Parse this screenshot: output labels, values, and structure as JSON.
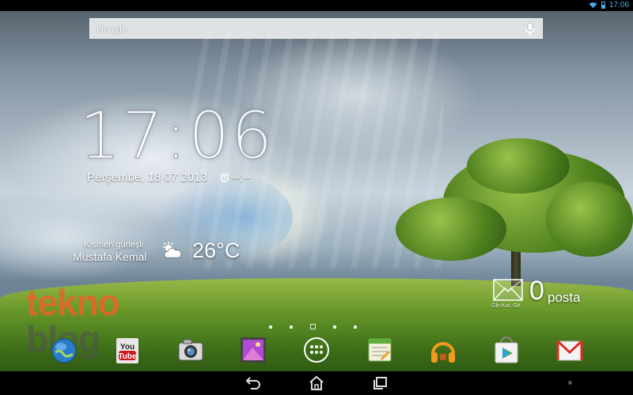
{
  "status_bar": {
    "time": "17:06",
    "colors": {
      "icons": "#4aa8e6"
    }
  },
  "search": {
    "label": "Google",
    "mic_icon": "microphone-icon"
  },
  "clock": {
    "time": "17:06"
  },
  "date": {
    "text": "Perşembe, 18 07 2013",
    "alarm_text": "--:--"
  },
  "weather": {
    "condition": "Kısmen güneşli",
    "location": "Mustafa Kemal",
    "temperature": "26°C",
    "icon": "partly-sunny-icon"
  },
  "mail": {
    "subtitle": "Gln Kut. Git",
    "count": "0",
    "label": "posta"
  },
  "pager": {
    "page_count": 5,
    "current_page": 3
  },
  "watermark": {
    "line1": "tekno",
    "line2": "blog"
  },
  "dock": {
    "apps": [
      {
        "name": "Browser",
        "icon": "globe-icon"
      },
      {
        "name": "YouTube",
        "icon": "youtube-icon"
      },
      {
        "name": "Camera",
        "icon": "camera-icon"
      },
      {
        "name": "Gallery",
        "icon": "gallery-icon"
      },
      {
        "name": "All apps",
        "icon": "app-drawer-icon"
      },
      {
        "name": "Notes",
        "icon": "notes-icon"
      },
      {
        "name": "Music",
        "icon": "headphones-icon"
      },
      {
        "name": "Play Store",
        "icon": "play-store-icon"
      },
      {
        "name": "Gmail",
        "icon": "gmail-icon"
      }
    ]
  },
  "navbar": {
    "buttons": [
      "back",
      "home",
      "recent-apps"
    ]
  }
}
